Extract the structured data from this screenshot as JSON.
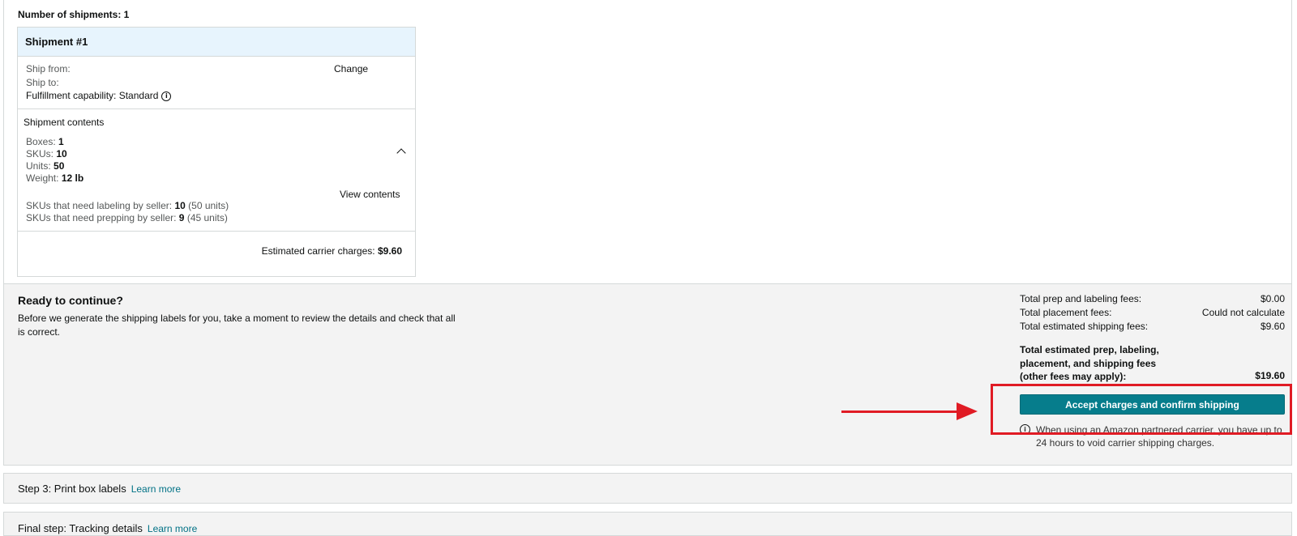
{
  "summary": {
    "num_shipments_label": "Number of shipments: 1"
  },
  "shipment": {
    "title": "Shipment #1",
    "ship_from_label": "Ship from:",
    "change_link": "Change",
    "ship_to_label": "Ship to:",
    "fulfillment_label": "Fulfillment capability: Standard",
    "contents_heading": "Shipment contents",
    "boxes_label": "Boxes:",
    "boxes_value": "1",
    "skus_label": "SKUs:",
    "skus_value": "10",
    "units_label": "Units:",
    "units_value": "50",
    "weight_label": "Weight:",
    "weight_value": "12 lb",
    "view_contents_link": "View contents",
    "labeling_label": "SKUs that need labeling by seller:",
    "labeling_value": "10",
    "labeling_units": "(50 units)",
    "prepping_label": "SKUs that need prepping by seller:",
    "prepping_value": "9",
    "prepping_units": "(45 units)",
    "carrier_charges_label": "Estimated carrier charges:",
    "carrier_charges_value": "$9.60"
  },
  "ready": {
    "title": "Ready to continue?",
    "description": "Before we generate the shipping labels for you, take a moment to review the details and check that all is correct."
  },
  "fees": {
    "prep_label": "Total prep and labeling fees:",
    "prep_value": "$0.00",
    "placement_label": "Total placement fees:",
    "placement_value": "Could not calculate",
    "shipping_label": "Total estimated shipping fees:",
    "shipping_value": "$9.60",
    "total_label": "Total estimated prep, labeling, placement, and shipping fees (other fees may apply):",
    "total_value": "$19.60"
  },
  "actions": {
    "accept_button": "Accept charges and confirm shipping",
    "void_info": "When using an Amazon partnered carrier, you have up to 24 hours to void carrier shipping charges."
  },
  "steps": {
    "step3_label": "Step 3: Print box labels",
    "step3_link": "Learn more",
    "final_label": "Final step: Tracking details",
    "final_link": "Learn more"
  },
  "colors": {
    "accent_button": "#067d8c",
    "link": "#007185",
    "annotation_red": "#e01b24",
    "header_blue": "#e7f4fd"
  }
}
